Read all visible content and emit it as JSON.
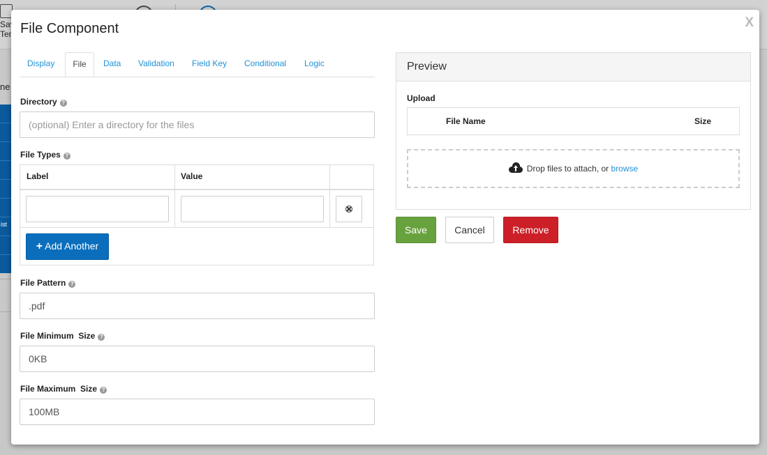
{
  "background": {
    "toolbar_items": [
      "Sav",
      "Tem"
    ],
    "side_label": "ne",
    "side_blue_text": "ist"
  },
  "modal": {
    "title": "File Component",
    "close_label": "X",
    "tabs": [
      {
        "label": "Display"
      },
      {
        "label": "File",
        "active": true
      },
      {
        "label": "Data"
      },
      {
        "label": "Validation"
      },
      {
        "label": "Field Key"
      },
      {
        "label": "Conditional"
      },
      {
        "label": "Logic"
      }
    ]
  },
  "form": {
    "directory": {
      "label": "Directory",
      "value": "",
      "placeholder": "(optional) Enter a directory for the files"
    },
    "file_types": {
      "label": "File Types",
      "columns": [
        "Label",
        "Value"
      ],
      "rows": [
        {
          "label": "",
          "value": ""
        }
      ],
      "add_label": "Add Another"
    },
    "file_pattern": {
      "label": "File Pattern",
      "value": ".pdf"
    },
    "file_min_size": {
      "label": "File Minimum  Size",
      "value": "0KB"
    },
    "file_max_size": {
      "label": "File Maximum  Size",
      "value": "100MB"
    }
  },
  "preview": {
    "title": "Preview",
    "upload_label": "Upload",
    "columns": [
      "File Name",
      "Size"
    ],
    "drop_text": "Drop files to attach, or ",
    "browse_label": "browse"
  },
  "actions": {
    "save": "Save",
    "cancel": "Cancel",
    "remove": "Remove"
  },
  "colors": {
    "primary": "#0a6ebd",
    "success": "#68a23e",
    "danger": "#cc1f27",
    "link": "#1e90d6"
  }
}
